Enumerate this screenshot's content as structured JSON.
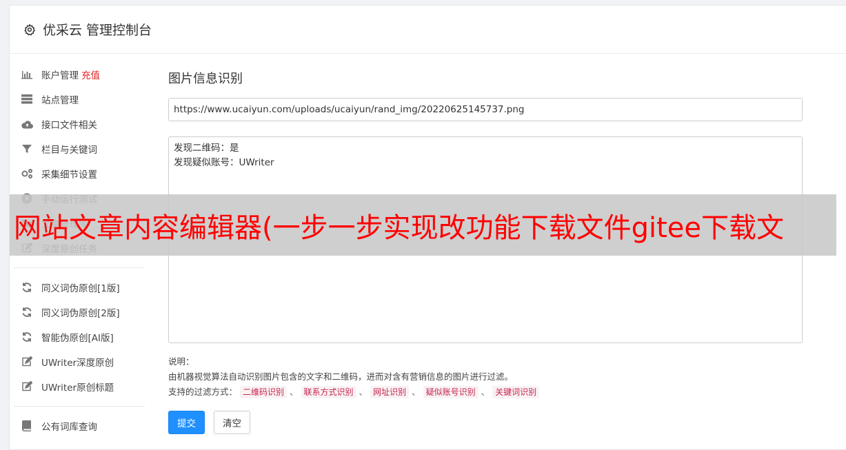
{
  "header": {
    "title": "优采云 管理控制台",
    "icon": "gear-icon"
  },
  "sidebar": {
    "groups": [
      [
        {
          "label": "账户管理",
          "badge": "充值",
          "icon": "bar-chart-icon"
        },
        {
          "label": "站点管理",
          "icon": "server-icon"
        },
        {
          "label": "接口文件相关",
          "icon": "cloud-upload-icon"
        },
        {
          "label": "栏目与关键词",
          "icon": "filter-icon"
        },
        {
          "label": "采集细节设置",
          "icon": "gears-icon"
        },
        {
          "label": "手动运行测试",
          "icon": "play-circle-icon"
        },
        {
          "label": "文章管理库",
          "icon": "folder-icon"
        },
        {
          "label": "深度原创任务",
          "icon": "edit-icon"
        }
      ],
      [
        {
          "label": "同义词伪原创[1版]",
          "icon": "refresh-icon"
        },
        {
          "label": "同义词伪原创[2版]",
          "icon": "refresh-icon"
        },
        {
          "label": "智能伪原创[AI版]",
          "icon": "refresh-icon"
        },
        {
          "label": "UWriter深度原创",
          "icon": "edit-icon"
        },
        {
          "label": "UWriter原创标题",
          "icon": "edit-icon"
        }
      ],
      [
        {
          "label": "公有词库查询",
          "icon": "book-icon"
        }
      ]
    ]
  },
  "main": {
    "title": "图片信息识别",
    "url_value": "https://www.ucaiyun.com/uploads/ucaiyun/rand_img/20220625145737.png",
    "result_text": "发现二维码：是\n发现疑似账号：UWriter",
    "notes_label": "说明：",
    "notes_desc": "由机器视觉算法自动识别图片包含的文字和二维码，进而对含有营销信息的图片进行过滤。",
    "filter_label": "支持的过滤方式：",
    "filter_tags": [
      "二维码识别",
      "联系方式识别",
      "网址识别",
      "疑似账号识别",
      "关键词识别"
    ],
    "filter_sep": "、",
    "submit_label": "提交",
    "clear_label": "清空"
  },
  "overlay": {
    "text": "网站文章内容编辑器(一步一步实现改功能下载文件gitee下载文"
  },
  "colors": {
    "accent": "#1e90ff",
    "badge": "#e02020",
    "tag_text": "#c7254e",
    "overlay_text": "#ff0000"
  }
}
